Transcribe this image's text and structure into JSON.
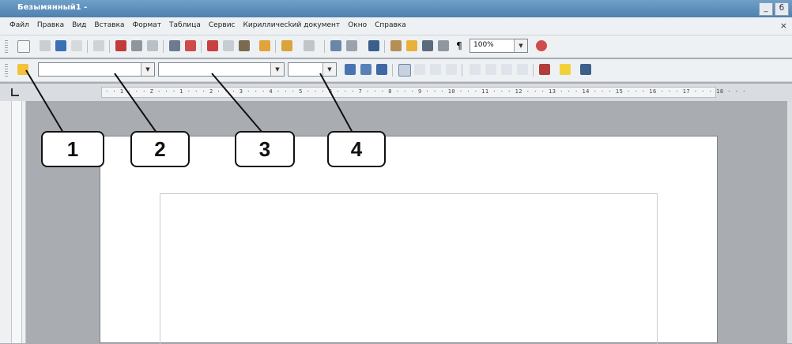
{
  "window": {
    "title": "Безымянный1 -",
    "buttons": [
      "_",
      "б"
    ]
  },
  "menu": {
    "items": [
      "Файл",
      "Правка",
      "Вид",
      "Вставка",
      "Формат",
      "Таблица",
      "Сервис",
      "Кирилличесkий документ",
      "Окно",
      "Справка"
    ],
    "close": "×"
  },
  "toolbar1": {
    "zoom_value": "100%"
  },
  "toolbar2": {
    "style_value": "",
    "font_value": "",
    "size_value": ""
  },
  "ruler": {
    "text": "· · 1 · · · Z · · · 1 · · · 2 · · · 3 · · · 4 · · · 5 · · · 6 · · · 7 · · · 8 · · · 9 · · · 10 · · · 11 · · · 12 · · · 13 · · · 14 · · · 15 · · · 16 · · · 17 · · · 18 · · ·"
  },
  "callouts": [
    "1",
    "2",
    "3",
    "4"
  ],
  "colors": {
    "titlebar": "#5b8cbb",
    "toolbar": "#eef1f4",
    "workspace": "#a9adb1"
  }
}
